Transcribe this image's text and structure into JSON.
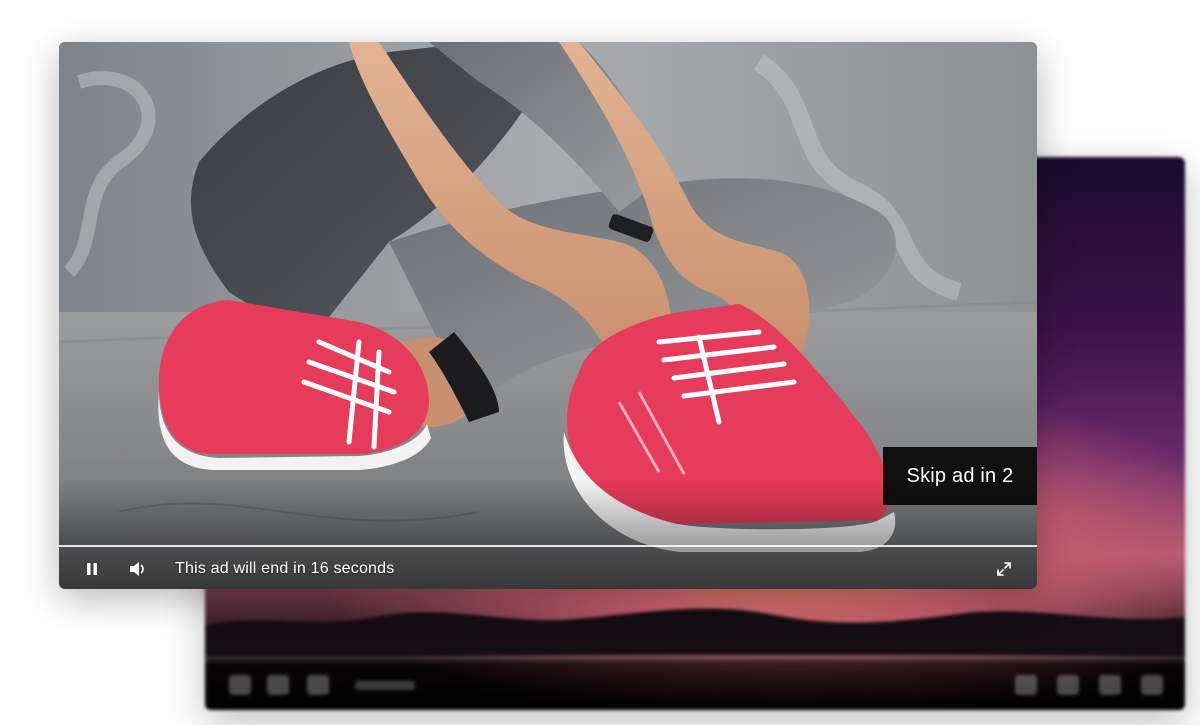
{
  "ad_player": {
    "skip_label": "Skip ad in 2",
    "ad_message": "This ad will end in 16 seconds",
    "progress": 1.0,
    "icons": {
      "pause": "pause-icon",
      "volume": "volume-icon",
      "fullscreen": "fullscreen-icon"
    }
  },
  "colors": {
    "shoe": "#e63b5a",
    "skip_bg": "#000000",
    "control_text": "#ffffff"
  },
  "background_player": {
    "icons": [
      "play-icon",
      "captions-icon",
      "settings-icon",
      "picture-in-picture-icon",
      "share-icon",
      "volume-icon",
      "fullscreen-icon"
    ]
  }
}
